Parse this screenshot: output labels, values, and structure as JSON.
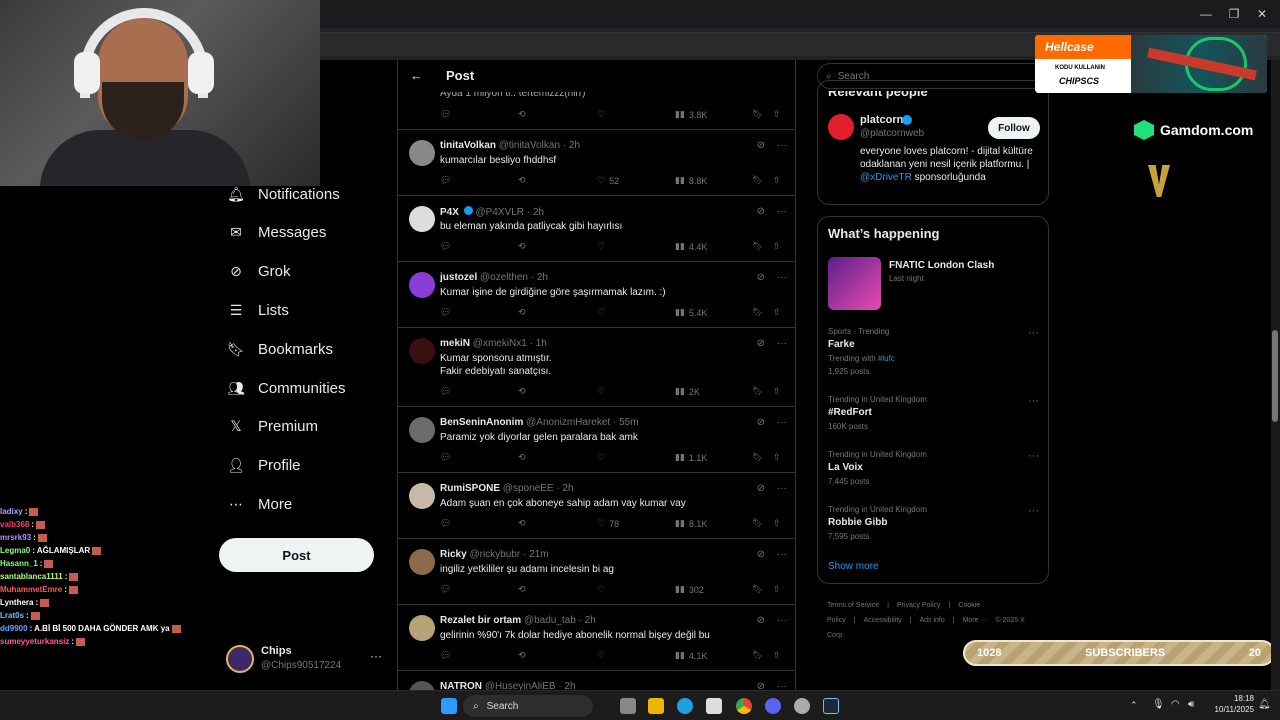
{
  "browser": {
    "minimize": "—",
    "maximize": "❐",
    "close": "✕"
  },
  "webcam_label": "",
  "chat": [
    {
      "user": "ladixy",
      "msg": ":",
      "color": "#9fa8ff"
    },
    {
      "user": "valb368",
      "msg": ":",
      "color": "#ff3f6b"
    },
    {
      "user": "mrsrk93",
      "msg": ":",
      "color": "#b38cff"
    },
    {
      "user": "Legma0",
      "msg": ": AĞLAMIŞLAR",
      "color": "#7fff7f"
    },
    {
      "user": "Hasann_1",
      "msg": ":",
      "color": "#7fff7f"
    },
    {
      "user": "santablanca1111",
      "msg": ":",
      "color": "#b0ff6a"
    },
    {
      "user": "MuhammetEmre",
      "msg": ":",
      "color": "#ff5a5a"
    },
    {
      "user": "Lynthera",
      "msg": ":",
      "color": "#ffffff"
    },
    {
      "user": "Lrat0s",
      "msg": ":",
      "color": "#66c2ff"
    },
    {
      "user": "dd9900",
      "msg": ": A.Bİ Bİ 500 DAHA GÖNDER AMK ya",
      "color": "#66a3ff"
    },
    {
      "user": "sumeyyeturkansiz",
      "msg": ":",
      "color": "#ff5aa0"
    }
  ],
  "nav": [
    {
      "label": "Notifications",
      "icon": "bell-icon"
    },
    {
      "label": "Messages",
      "icon": "mail-icon"
    },
    {
      "label": "Grok",
      "icon": "grok-icon"
    },
    {
      "label": "Lists",
      "icon": "list-icon"
    },
    {
      "label": "Bookmarks",
      "icon": "bookmark-icon"
    },
    {
      "label": "Communities",
      "icon": "people-icon"
    },
    {
      "label": "Premium",
      "icon": "x-logo-icon"
    },
    {
      "label": "Profile",
      "icon": "person-icon"
    },
    {
      "label": "More",
      "icon": "more-circle-icon"
    }
  ],
  "post_button": "Post",
  "account": {
    "name": "Chips",
    "handle": "@Chips90517224",
    "more": "···"
  },
  "feed": {
    "title": "Post",
    "partial_top": {
      "text": "Ayda 1 milyon tl.. tertemizzz(hlrr)",
      "views": "3.8K"
    },
    "tweets": [
      {
        "name": "tinitaVolkan",
        "handle": "@tinitaVolkan · 2h",
        "text": "kumarcılar besliyo fhddhsf",
        "likes": "52",
        "views": "8.8K",
        "avatar": "#888"
      },
      {
        "name": "P4X",
        "handle": "@P4XVLR · 2h",
        "text": "bu eleman yakında patliycak gibi hayırlısı",
        "likes": "",
        "views": "4.4K",
        "avatar": "#ddd",
        "verified": true
      },
      {
        "name": "justozel",
        "handle": "@ozelthen · 2h",
        "text": "Kumar işine de girdiğine göre şaşırmamak lazım. :)",
        "likes": "",
        "views": "5.4K",
        "avatar": "#8a3dd6"
      },
      {
        "name": "mekiN",
        "handle": "@xmekiNx1 · 1h",
        "text": "Kumar sponsoru atmıştır.",
        "text2": "Fakir edebiyatı sanatçısı.",
        "likes": "",
        "views": "2K",
        "avatar": "#3a0f0f"
      },
      {
        "name": "BenSeninAnonim",
        "handle": "@AnonizmHareket · 55m",
        "text": "Paramiz yok diyorlar gelen paralara bak amk",
        "likes": "",
        "views": "1.1K",
        "avatar": "#6b6b6b"
      },
      {
        "name": "RumiSPONE",
        "handle": "@sponeEE · 2h",
        "text": "Adam şuan en çok aboneye sahip adam vay kumar vay",
        "likes": "78",
        "views": "8.1K",
        "avatar": "#c7b9a8"
      },
      {
        "name": "Ricky",
        "handle": "@rickybubr · 21m",
        "text": "ingiliz yetkililer şu adamı incelesin bi ag",
        "likes": "",
        "views": "302",
        "avatar": "#8a6a4a"
      },
      {
        "name": "Rezalet bir ortam",
        "handle": "@badu_tab · 2h",
        "text": "gelirinin %90'ı 7k dolar hediye abonelik normal bişey değil bu",
        "likes": "",
        "views": "4.1K",
        "avatar": "#b8a27a"
      },
      {
        "name": "NATRON",
        "handle": "@HuseyinAliEB · 2h",
        "text": "",
        "likes": "",
        "views": "",
        "avatar": "#555"
      }
    ]
  },
  "right": {
    "search_placeholder": "Search",
    "relevant_title": "Relevant people",
    "person": {
      "name": "platcorn",
      "handle": "@platcornweb",
      "follow": "Follow",
      "bio": "everyone loves platcorn! - dijital kültüre odaklanan yeni nesil içerik platformu. |",
      "bio_link": "@xDriveTR",
      "bio_end": "sponsorluğunda"
    },
    "happening_title": "What’s happening",
    "event": {
      "title": "FNATIC London Clash",
      "sub": "Last night"
    },
    "trends": [
      {
        "ctx": "Sports · Trending",
        "title": "Farke",
        "with": "Trending with ",
        "tag": "#lufc",
        "count": "1,925 posts"
      },
      {
        "ctx": "Trending in United Kingdom",
        "title": "#RedFort",
        "count": "160K posts"
      },
      {
        "ctx": "Trending in United Kingdom",
        "title": "La Voix",
        "count": "7,445 posts"
      },
      {
        "ctx": "Trending in United Kingdom",
        "title": "Robbie Gibb",
        "count": "7,595 posts"
      }
    ],
    "show_more": "Show more",
    "footer": [
      "Terms of Service",
      "|",
      "Privacy Policy",
      "|",
      "Cookie Policy",
      "|",
      "Accessibility",
      "|",
      "Ads info",
      "|",
      "More ···",
      "© 2025 X Corp."
    ]
  },
  "sponsors": {
    "hellcase": "Hellcase",
    "hellcase_line1": "KODU KULLANIN",
    "hellcase_line2": "CHIPSCS",
    "gamdom": "Gamdom.com",
    "subs_left": "1028",
    "subs_label": "SUBSCRIBERS",
    "subs_right": "20"
  },
  "taskbar": {
    "search": "Search",
    "time": "18:18",
    "date": "10/11/2025"
  }
}
